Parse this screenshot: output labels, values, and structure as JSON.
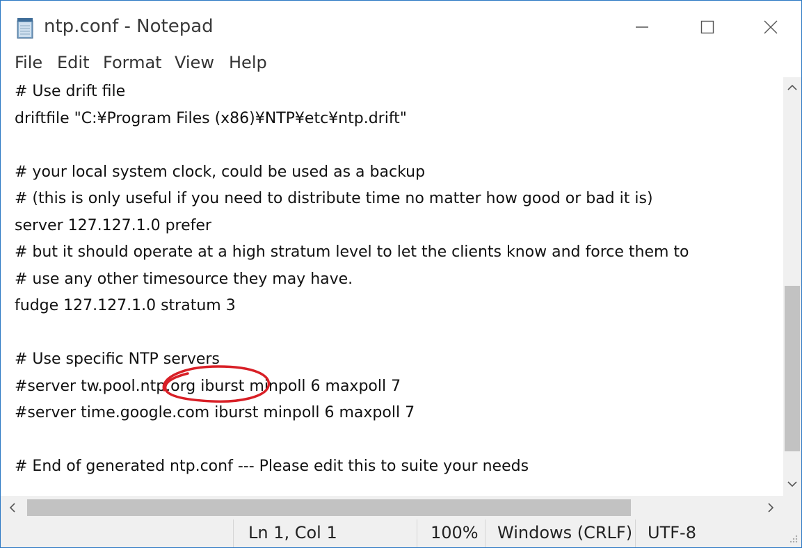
{
  "window": {
    "title": "ntp.conf - Notepad",
    "icon": "notepad-icon",
    "accent_color": "#2b78c4"
  },
  "menu": {
    "items": [
      "File",
      "Edit",
      "Format",
      "View",
      "Help"
    ]
  },
  "editor": {
    "lines": [
      "# Use drift file",
      "driftfile \"C:¥Program Files (x86)¥NTP¥etc¥ntp.drift\"",
      "",
      "# your local system clock, could be used as a backup",
      "# (this is only useful if you need to distribute time no matter how good or bad it is)",
      "server 127.127.1.0 prefer",
      "# but it should operate at a high stratum level to let the clients know and force them to",
      "# use any other timesource they may have.",
      "fudge 127.127.1.0 stratum 3",
      "",
      "# Use specific NTP servers",
      "#server tw.pool.ntp.org iburst minpoll 6 maxpoll 7",
      "#server time.google.com iburst minpoll 6 maxpoll 7",
      "",
      "# End of generated ntp.conf --- Please edit this to suite your needs"
    ],
    "annotation_color": "#d81f26"
  },
  "status": {
    "position": "Ln 1, Col 1",
    "zoom": "100%",
    "line_ending": "Windows (CRLF)",
    "encoding": "UTF-8"
  }
}
